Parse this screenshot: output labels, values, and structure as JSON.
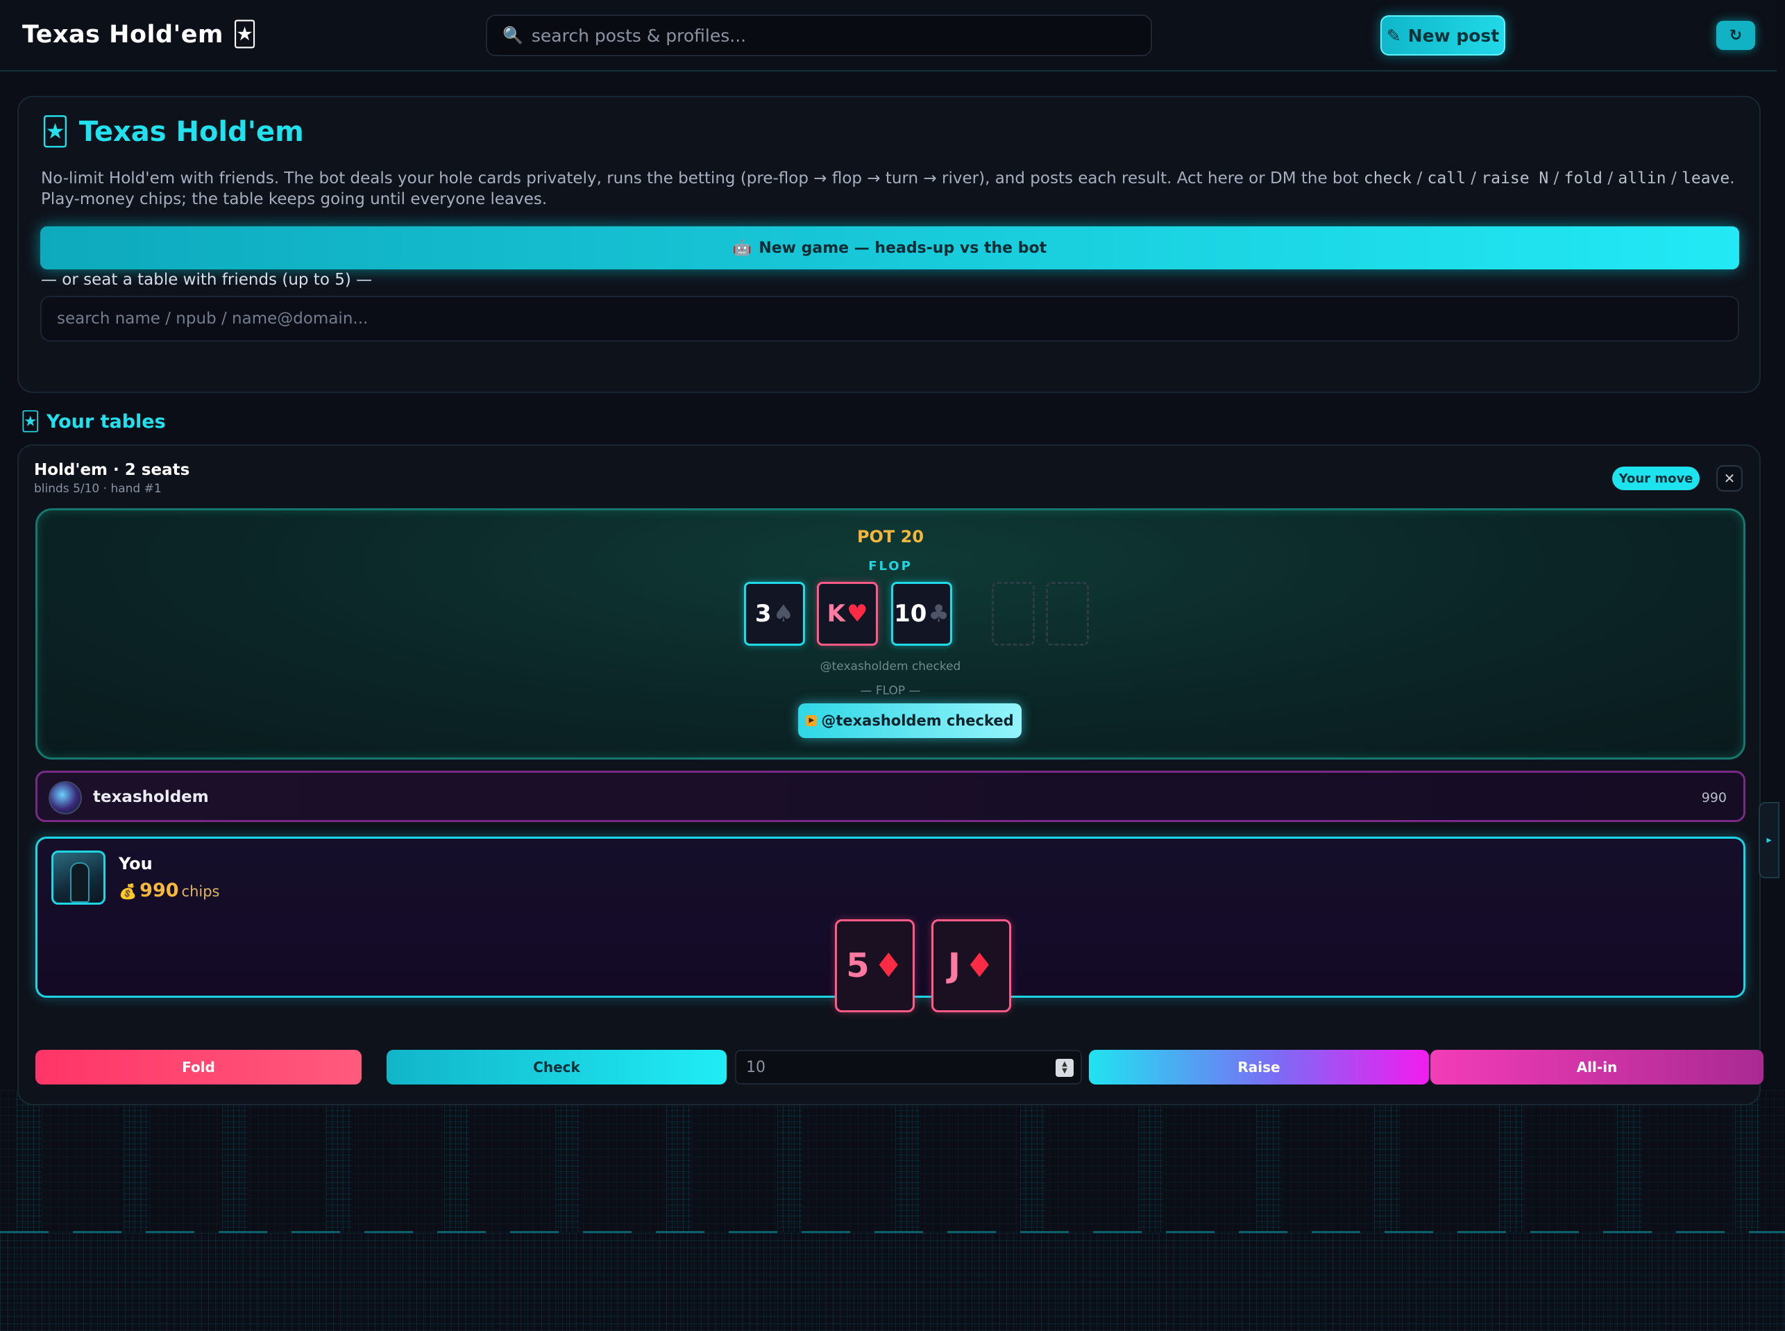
{
  "header": {
    "brand": "Texas Hold'em 🃏",
    "search_placeholder": "search posts & profiles...",
    "search_icon": "🔍",
    "new_post_label": "New post",
    "new_post_icon": "✎",
    "refresh_icon": "↻"
  },
  "intro": {
    "title": "🃏 Texas Hold'em",
    "desc_before": "No-limit Hold'em with friends. The bot deals your hole cards privately, runs the betting (pre-flop → flop → turn → river), and posts each result. Act here or DM the bot ",
    "desc_check": "check",
    "desc_sep1": " / ",
    "desc_call": "call",
    "desc_sep2": " / ",
    "desc_raise": "raise N",
    "desc_sep3": " / ",
    "desc_fold": "fold",
    "desc_sep4": " / ",
    "desc_allin": "allin",
    "desc_sep5": " / ",
    "desc_leave": "leave",
    "desc_after": ". Play-money chips; the table keeps going until everyone leaves.",
    "new_game_icon": "🤖",
    "new_game_label": "New game — heads-up vs the bot",
    "or_seat": "— or seat a table with friends (up to 5) —",
    "friend_placeholder": "search name / npub / name@domain..."
  },
  "tables_section": {
    "title": "🃏 Your tables"
  },
  "table": {
    "title": "Hold'em · 2 seats",
    "subtitle": "blinds 5/10 · hand #1",
    "badge": "Your move",
    "close_icon": "✕",
    "pot": "POT 20",
    "street": "FLOP",
    "board": [
      {
        "rank": "3",
        "suit": "♠",
        "color": "black"
      },
      {
        "rank": "K",
        "suit": "♥",
        "color": "red"
      },
      {
        "rank": "10",
        "suit": "♣",
        "color": "black"
      }
    ],
    "log_line": "@texasholdem checked",
    "log_sep": "— FLOP —",
    "log_chip": "@texasholdem checked",
    "opponent": {
      "name": "texasholdem",
      "chips": "990"
    },
    "me": {
      "name": "You",
      "chips_icon": "💰",
      "chips_value": "990",
      "chips_label": "chips",
      "hole": [
        {
          "rank": "5",
          "suit": "♦"
        },
        {
          "rank": "J",
          "suit": "♦"
        }
      ]
    },
    "actions": {
      "fold": "Fold",
      "check": "Check",
      "amount_value": "10",
      "raise": "Raise",
      "allin": "All-in"
    }
  },
  "side_tab_icon": "▸",
  "colors": {
    "accent": "#22e1ee",
    "gold": "#f4b63c",
    "red_card": "#ff5b86",
    "fold": "#ff3567",
    "allin": "#f33cb8"
  }
}
